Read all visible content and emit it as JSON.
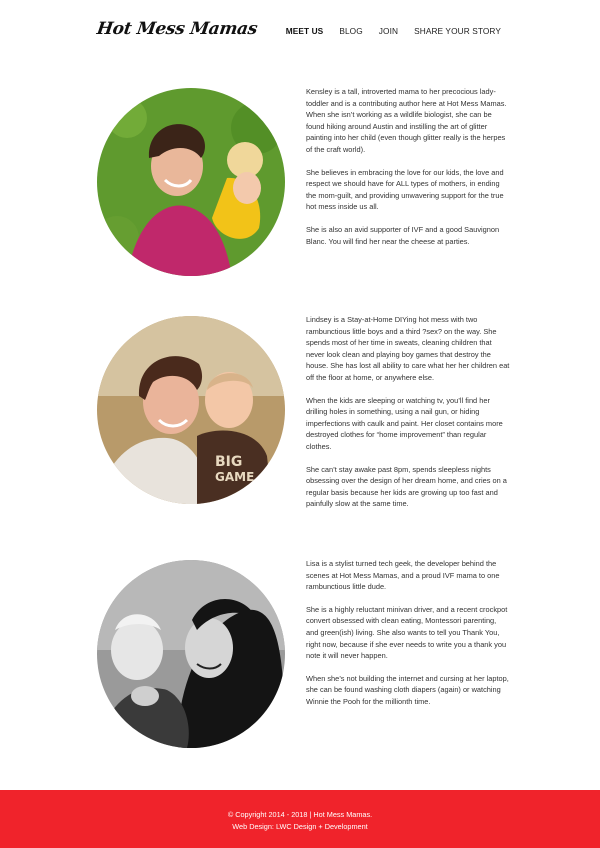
{
  "site": {
    "logo": "Hot Mess Mamas"
  },
  "nav": {
    "items": [
      {
        "label": "MEET US"
      },
      {
        "label": "BLOG"
      },
      {
        "label": "JOIN"
      },
      {
        "label": "SHARE YOUR STORY"
      }
    ]
  },
  "profiles": [
    {
      "paragraphs": [
        "Kensley is a tall, introverted mama to her precocious lady-toddler and is a contributing author here at Hot Mess Mamas. When she isn’t working as a wildlife biologist, she can be found hiking around Austin and instilling the art of glitter painting into her child (even though glitter really is the herpes of the craft world).",
        "She believes in embracing the love for our kids, the love and respect we should have for ALL types of mothers, in ending the mom-guilt, and providing unwavering support for the true hot mess inside us all.",
        "She is also an avid supporter of IVF and a good Sauvignon Blanc. You will find her near the cheese at parties."
      ]
    },
    {
      "paragraphs": [
        "Lindsey is a Stay-at-Home DIYing hot mess with two rambunctious little boys and a third ?sex? on the way. She spends most of her time in sweats, cleaning children that never look clean and playing boy games that destroy the house. She has lost all ability to care what her her children eat off the floor at home, or anywhere else.",
        "When the kids are sleeping or watching tv, you’ll find her drilling holes in something, using a nail gun, or hiding imperfections with caulk and paint. Her closet contains more destroyed clothes for “home improvement” than regular clothes.",
        "She can’t stay awake past 8pm, spends sleepless nights obsessing over the design of her dream home, and cries on a regular basis because her kids are growing up too fast and painfully slow at the same time."
      ]
    },
    {
      "paragraphs": [
        "Lisa is a stylist turned tech geek, the developer behind the scenes at Hot Mess Mamas, and a proud IVF mama to one rambunctious little dude.",
        "She is a highly reluctant minivan driver, and a recent crockpot convert obsessed with clean eating, Montessori parenting, and green(ish) living. She also wants to tell you Thank You, right now, because if she ever needs to write you a thank you note it will never happen.",
        "When she’s not building the internet and cursing at her laptop, she can be found washing cloth diapers (again) or watching Winnie the Pooh for the millionth time."
      ]
    }
  ],
  "footer": {
    "copyright": "© Copyright 2014 - 2018 | Hot Mess Mamas.",
    "credit": "Web Design: LWC Design + Development"
  },
  "colors": {
    "footer_bg": "#f0232b",
    "text": "#333333"
  }
}
